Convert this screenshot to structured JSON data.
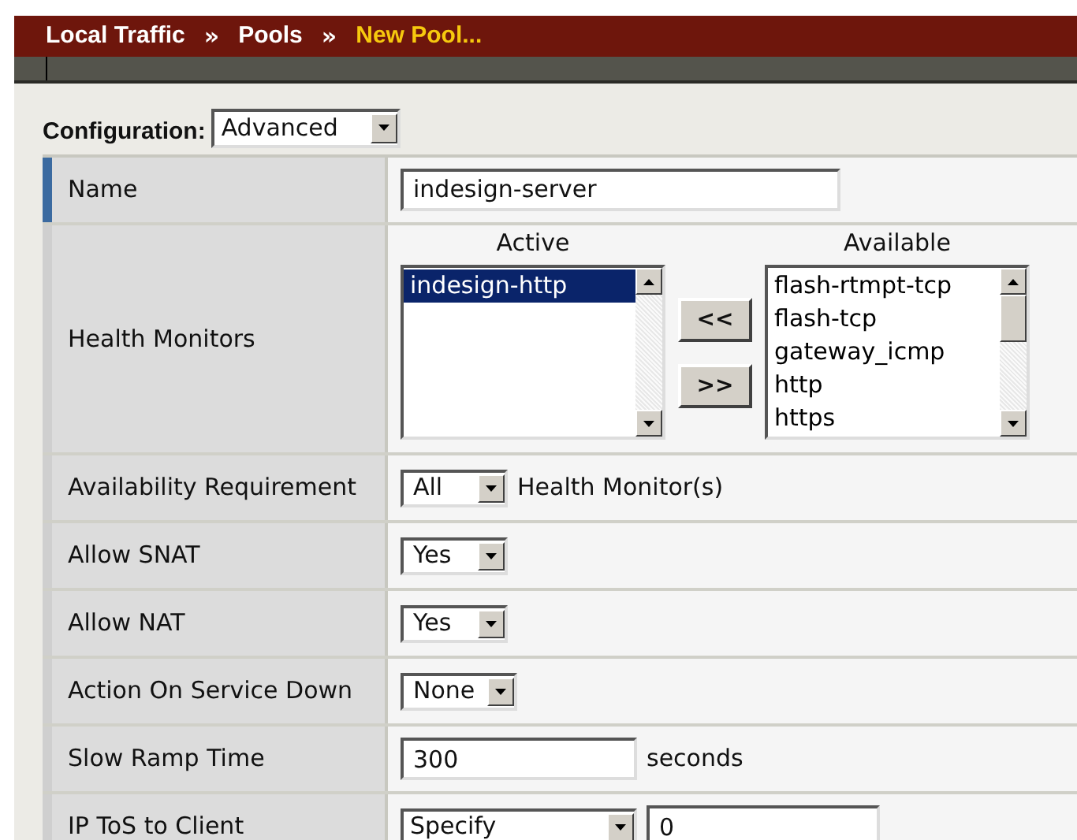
{
  "breadcrumb": [
    {
      "kind": "crumb",
      "label": "Local Traffic",
      "selected": false
    },
    {
      "kind": "separator",
      "label": "»"
    },
    {
      "kind": "crumb",
      "label": "Pools",
      "selected": false
    },
    {
      "kind": "separator",
      "label": "»"
    },
    {
      "kind": "crumb",
      "label": "New Pool...",
      "selected": true
    }
  ],
  "configuration": {
    "label": "Configuration:",
    "value": "Advanced"
  },
  "rows": [
    {
      "kind": "text_input",
      "label": "Name",
      "marked": true,
      "value": "indesign-server"
    },
    {
      "kind": "dual_list",
      "label": "Health Monitors",
      "marked": false,
      "active": {
        "title": "Active",
        "items": [
          {
            "label": "indesign-http",
            "selected": true
          }
        ]
      },
      "move_left": "<<",
      "move_right": ">>",
      "available": {
        "title": "Available",
        "items": [
          {
            "label": "flash-rtmpt-tcp",
            "selected": false
          },
          {
            "label": "flash-tcp",
            "selected": false
          },
          {
            "label": "gateway_icmp",
            "selected": false
          },
          {
            "label": "http",
            "selected": false
          },
          {
            "label": "https",
            "selected": false
          }
        ]
      }
    },
    {
      "kind": "select",
      "label": "Availability Requirement",
      "marked": false,
      "value": "All",
      "suffix": "Health Monitor(s)"
    },
    {
      "kind": "select",
      "label": "Allow SNAT",
      "marked": false,
      "value": "Yes"
    },
    {
      "kind": "select",
      "label": "Allow NAT",
      "marked": false,
      "value": "Yes"
    },
    {
      "kind": "select",
      "label": "Action On Service Down",
      "marked": false,
      "value": "None"
    },
    {
      "kind": "text_input",
      "label": "Slow Ramp Time",
      "marked": false,
      "value": "300",
      "suffix": "seconds"
    },
    {
      "kind": "select_input",
      "label": "IP ToS to Client",
      "marked": false,
      "value": "Specify",
      "input": "0"
    }
  ]
}
